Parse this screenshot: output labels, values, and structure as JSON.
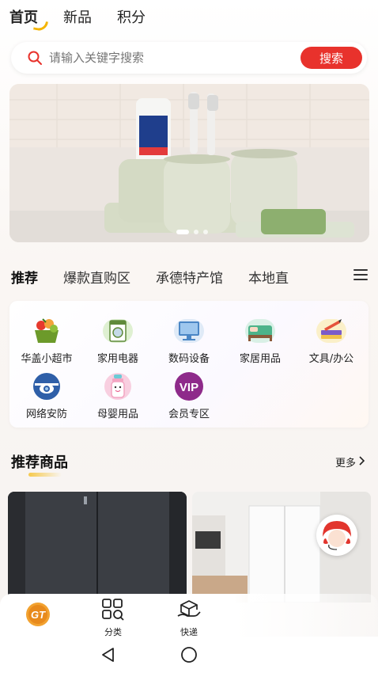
{
  "top_tabs": [
    "首页",
    "新品",
    "积分"
  ],
  "search": {
    "placeholder": "请输入关键字搜索",
    "button": "搜索"
  },
  "category_tabs": [
    "推荐",
    "爆款直购区",
    "承德特产馆",
    "本地直"
  ],
  "categories": [
    {
      "label": "华盖小超市",
      "icon": "fruit-basket-icon"
    },
    {
      "label": "家用电器",
      "icon": "washing-machine-icon"
    },
    {
      "label": "数码设备",
      "icon": "computer-icon"
    },
    {
      "label": "家居用品",
      "icon": "bed-icon"
    },
    {
      "label": "文具/办公",
      "icon": "stationery-icon"
    },
    {
      "label": "网络安防",
      "icon": "security-camera-icon"
    },
    {
      "label": "母婴用品",
      "icon": "baby-bottle-icon"
    },
    {
      "label": "会员专区",
      "icon": "vip-icon",
      "icon_text": "VIP"
    }
  ],
  "recommend": {
    "title": "推荐商品",
    "more": "更多"
  },
  "bottom_nav": [
    {
      "label": "",
      "icon": "home-logo-icon",
      "logo_text": "GT"
    },
    {
      "label": "分类",
      "icon": "category-grid-icon"
    },
    {
      "label": "快递",
      "icon": "delivery-box-icon"
    }
  ],
  "colors": {
    "accent": "#e8322c",
    "highlight": "#f6c94c",
    "vip": "#8e2a8a"
  }
}
